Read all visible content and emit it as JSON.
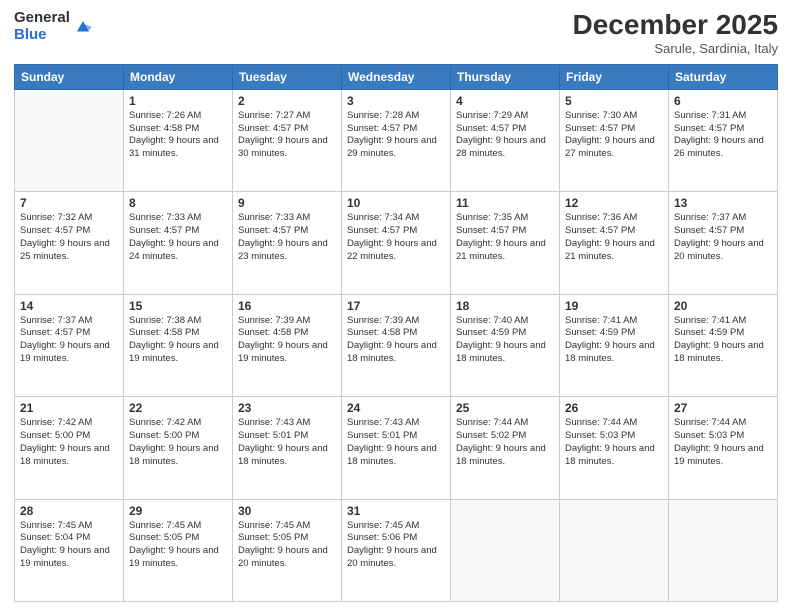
{
  "header": {
    "logo_general": "General",
    "logo_blue": "Blue",
    "month_title": "December 2025",
    "location": "Sarule, Sardinia, Italy"
  },
  "days_of_week": [
    "Sunday",
    "Monday",
    "Tuesday",
    "Wednesday",
    "Thursday",
    "Friday",
    "Saturday"
  ],
  "weeks": [
    [
      {
        "num": "",
        "sunrise": "",
        "sunset": "",
        "daylight": ""
      },
      {
        "num": "1",
        "sunrise": "Sunrise: 7:26 AM",
        "sunset": "Sunset: 4:58 PM",
        "daylight": "Daylight: 9 hours and 31 minutes."
      },
      {
        "num": "2",
        "sunrise": "Sunrise: 7:27 AM",
        "sunset": "Sunset: 4:57 PM",
        "daylight": "Daylight: 9 hours and 30 minutes."
      },
      {
        "num": "3",
        "sunrise": "Sunrise: 7:28 AM",
        "sunset": "Sunset: 4:57 PM",
        "daylight": "Daylight: 9 hours and 29 minutes."
      },
      {
        "num": "4",
        "sunrise": "Sunrise: 7:29 AM",
        "sunset": "Sunset: 4:57 PM",
        "daylight": "Daylight: 9 hours and 28 minutes."
      },
      {
        "num": "5",
        "sunrise": "Sunrise: 7:30 AM",
        "sunset": "Sunset: 4:57 PM",
        "daylight": "Daylight: 9 hours and 27 minutes."
      },
      {
        "num": "6",
        "sunrise": "Sunrise: 7:31 AM",
        "sunset": "Sunset: 4:57 PM",
        "daylight": "Daylight: 9 hours and 26 minutes."
      }
    ],
    [
      {
        "num": "7",
        "sunrise": "Sunrise: 7:32 AM",
        "sunset": "Sunset: 4:57 PM",
        "daylight": "Daylight: 9 hours and 25 minutes."
      },
      {
        "num": "8",
        "sunrise": "Sunrise: 7:33 AM",
        "sunset": "Sunset: 4:57 PM",
        "daylight": "Daylight: 9 hours and 24 minutes."
      },
      {
        "num": "9",
        "sunrise": "Sunrise: 7:33 AM",
        "sunset": "Sunset: 4:57 PM",
        "daylight": "Daylight: 9 hours and 23 minutes."
      },
      {
        "num": "10",
        "sunrise": "Sunrise: 7:34 AM",
        "sunset": "Sunset: 4:57 PM",
        "daylight": "Daylight: 9 hours and 22 minutes."
      },
      {
        "num": "11",
        "sunrise": "Sunrise: 7:35 AM",
        "sunset": "Sunset: 4:57 PM",
        "daylight": "Daylight: 9 hours and 21 minutes."
      },
      {
        "num": "12",
        "sunrise": "Sunrise: 7:36 AM",
        "sunset": "Sunset: 4:57 PM",
        "daylight": "Daylight: 9 hours and 21 minutes."
      },
      {
        "num": "13",
        "sunrise": "Sunrise: 7:37 AM",
        "sunset": "Sunset: 4:57 PM",
        "daylight": "Daylight: 9 hours and 20 minutes."
      }
    ],
    [
      {
        "num": "14",
        "sunrise": "Sunrise: 7:37 AM",
        "sunset": "Sunset: 4:57 PM",
        "daylight": "Daylight: 9 hours and 19 minutes."
      },
      {
        "num": "15",
        "sunrise": "Sunrise: 7:38 AM",
        "sunset": "Sunset: 4:58 PM",
        "daylight": "Daylight: 9 hours and 19 minutes."
      },
      {
        "num": "16",
        "sunrise": "Sunrise: 7:39 AM",
        "sunset": "Sunset: 4:58 PM",
        "daylight": "Daylight: 9 hours and 19 minutes."
      },
      {
        "num": "17",
        "sunrise": "Sunrise: 7:39 AM",
        "sunset": "Sunset: 4:58 PM",
        "daylight": "Daylight: 9 hours and 18 minutes."
      },
      {
        "num": "18",
        "sunrise": "Sunrise: 7:40 AM",
        "sunset": "Sunset: 4:59 PM",
        "daylight": "Daylight: 9 hours and 18 minutes."
      },
      {
        "num": "19",
        "sunrise": "Sunrise: 7:41 AM",
        "sunset": "Sunset: 4:59 PM",
        "daylight": "Daylight: 9 hours and 18 minutes."
      },
      {
        "num": "20",
        "sunrise": "Sunrise: 7:41 AM",
        "sunset": "Sunset: 4:59 PM",
        "daylight": "Daylight: 9 hours and 18 minutes."
      }
    ],
    [
      {
        "num": "21",
        "sunrise": "Sunrise: 7:42 AM",
        "sunset": "Sunset: 5:00 PM",
        "daylight": "Daylight: 9 hours and 18 minutes."
      },
      {
        "num": "22",
        "sunrise": "Sunrise: 7:42 AM",
        "sunset": "Sunset: 5:00 PM",
        "daylight": "Daylight: 9 hours and 18 minutes."
      },
      {
        "num": "23",
        "sunrise": "Sunrise: 7:43 AM",
        "sunset": "Sunset: 5:01 PM",
        "daylight": "Daylight: 9 hours and 18 minutes."
      },
      {
        "num": "24",
        "sunrise": "Sunrise: 7:43 AM",
        "sunset": "Sunset: 5:01 PM",
        "daylight": "Daylight: 9 hours and 18 minutes."
      },
      {
        "num": "25",
        "sunrise": "Sunrise: 7:44 AM",
        "sunset": "Sunset: 5:02 PM",
        "daylight": "Daylight: 9 hours and 18 minutes."
      },
      {
        "num": "26",
        "sunrise": "Sunrise: 7:44 AM",
        "sunset": "Sunset: 5:03 PM",
        "daylight": "Daylight: 9 hours and 18 minutes."
      },
      {
        "num": "27",
        "sunrise": "Sunrise: 7:44 AM",
        "sunset": "Sunset: 5:03 PM",
        "daylight": "Daylight: 9 hours and 19 minutes."
      }
    ],
    [
      {
        "num": "28",
        "sunrise": "Sunrise: 7:45 AM",
        "sunset": "Sunset: 5:04 PM",
        "daylight": "Daylight: 9 hours and 19 minutes."
      },
      {
        "num": "29",
        "sunrise": "Sunrise: 7:45 AM",
        "sunset": "Sunset: 5:05 PM",
        "daylight": "Daylight: 9 hours and 19 minutes."
      },
      {
        "num": "30",
        "sunrise": "Sunrise: 7:45 AM",
        "sunset": "Sunset: 5:05 PM",
        "daylight": "Daylight: 9 hours and 20 minutes."
      },
      {
        "num": "31",
        "sunrise": "Sunrise: 7:45 AM",
        "sunset": "Sunset: 5:06 PM",
        "daylight": "Daylight: 9 hours and 20 minutes."
      },
      {
        "num": "",
        "sunrise": "",
        "sunset": "",
        "daylight": ""
      },
      {
        "num": "",
        "sunrise": "",
        "sunset": "",
        "daylight": ""
      },
      {
        "num": "",
        "sunrise": "",
        "sunset": "",
        "daylight": ""
      }
    ]
  ]
}
